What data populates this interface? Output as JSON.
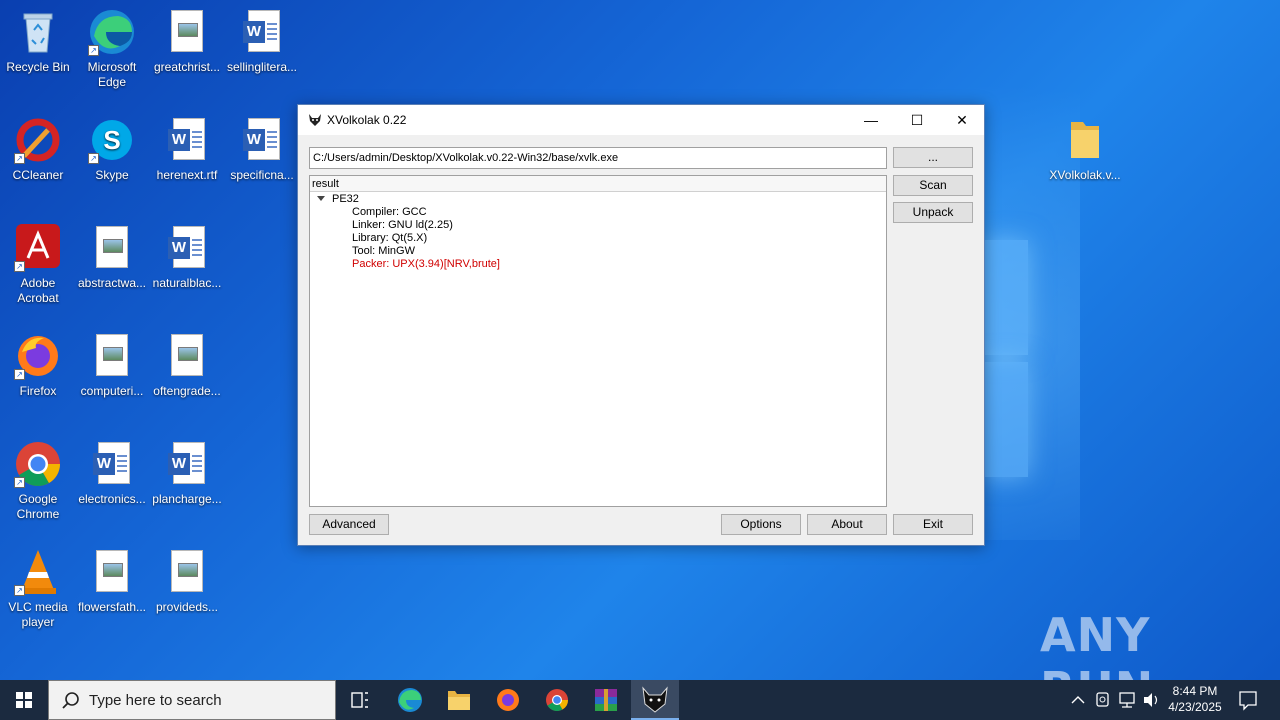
{
  "desktop": {
    "icons": [
      {
        "label": "Recycle Bin",
        "icon": "recycle-bin-icon"
      },
      {
        "label": "Microsoft Edge",
        "icon": "edge-icon"
      },
      {
        "label": "greatchrist...",
        "icon": "image-file-icon"
      },
      {
        "label": "sellinglitera...",
        "icon": "word-doc-icon"
      },
      {
        "label": "CCleaner",
        "icon": "ccleaner-icon"
      },
      {
        "label": "Skype",
        "icon": "skype-icon"
      },
      {
        "label": "herenext.rtf",
        "icon": "word-doc-icon"
      },
      {
        "label": "specificna...",
        "icon": "word-doc-icon"
      },
      {
        "label": "Adobe Acrobat",
        "icon": "acrobat-icon"
      },
      {
        "label": "abstractwa...",
        "icon": "image-file-icon"
      },
      {
        "label": "naturalblac...",
        "icon": "word-doc-icon"
      },
      {
        "label": "Firefox",
        "icon": "firefox-icon"
      },
      {
        "label": "computeri...",
        "icon": "image-file-icon"
      },
      {
        "label": "oftengrade...",
        "icon": "image-file-icon"
      },
      {
        "label": "Google Chrome",
        "icon": "chrome-icon"
      },
      {
        "label": "electronics...",
        "icon": "word-doc-icon"
      },
      {
        "label": "plancharge...",
        "icon": "word-doc-icon"
      },
      {
        "label": "VLC media player",
        "icon": "vlc-icon"
      },
      {
        "label": "flowersfath...",
        "icon": "image-file-icon"
      },
      {
        "label": "provideds...",
        "icon": "image-file-icon"
      },
      {
        "label": "XVolkolak.v...",
        "icon": "folder-icon"
      }
    ]
  },
  "window": {
    "title": "XVolkolak 0.22",
    "minimize": "—",
    "maximize": "☐",
    "close": "✕",
    "path_value": "C:/Users/admin/Desktop/XVolkolak.v0.22-Win32/base/xvlk.exe",
    "browse_label": "...",
    "scan_label": "Scan",
    "unpack_label": "Unpack",
    "result_header": "result",
    "tree": {
      "root": "PE32",
      "children": [
        {
          "text": "Compiler: GCC",
          "color": "#000000"
        },
        {
          "text": "Linker: GNU ld(2.25)",
          "color": "#000000"
        },
        {
          "text": "Library: Qt(5.X)",
          "color": "#000000"
        },
        {
          "text": "Tool: MinGW",
          "color": "#000000"
        },
        {
          "text": "Packer: UPX(3.94)[NRV,brute]",
          "color": "#d00000"
        }
      ]
    },
    "advanced_label": "Advanced",
    "options_label": "Options",
    "about_label": "About",
    "exit_label": "Exit"
  },
  "taskbar": {
    "search_placeholder": "Type here to search",
    "time": "8:44 PM",
    "date": "4/23/2025"
  },
  "watermark": "ANY RUN"
}
